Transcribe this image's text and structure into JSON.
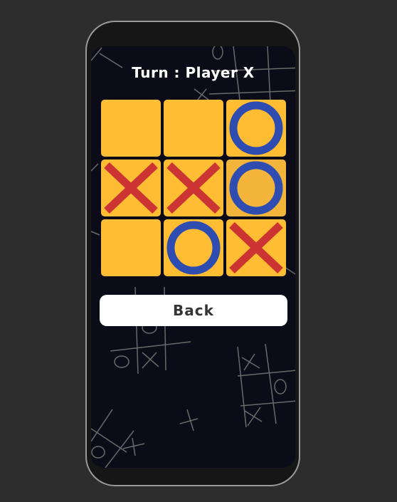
{
  "header": {
    "turn_text": "Turn : Player X"
  },
  "board": {
    "cells": [
      "",
      "",
      "O",
      "X",
      "X",
      "O",
      "",
      "O",
      "X"
    ],
    "highlighted_cell": 5
  },
  "colors": {
    "cell": "#ffbd33",
    "x_mark": "#cc3333",
    "o_mark": "#2f4db0",
    "background": "#0b0c18"
  },
  "back_button": {
    "label": "Back"
  }
}
